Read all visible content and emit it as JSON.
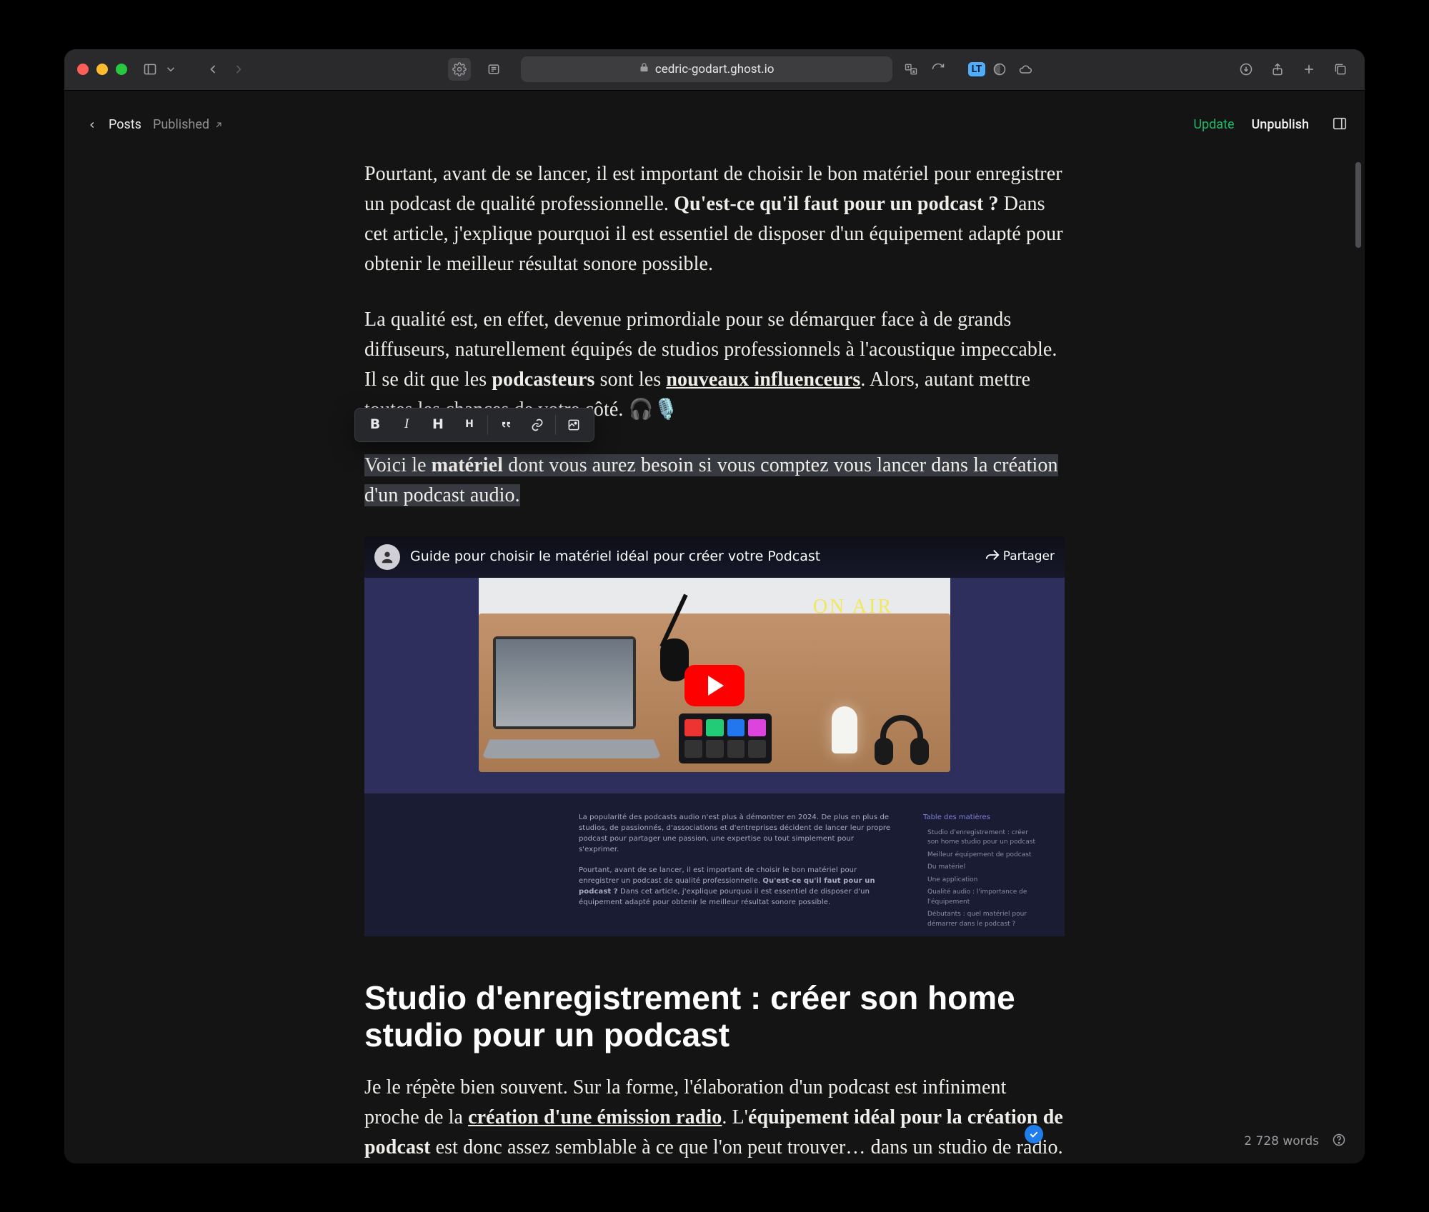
{
  "browser": {
    "url_display": "cedric-godart.ghost.io",
    "lt_badge": "LT"
  },
  "editor_header": {
    "back_label": "Posts",
    "status": "Published",
    "action_update": "Update",
    "action_unpublish": "Unpublish"
  },
  "article": {
    "p1_a": "Pourtant, avant de se lancer, il est important de choisir le bon matériel pour enregistrer un podcast de qualité professionnelle. ",
    "p1_bold": "Qu'est-ce qu'il faut pour un podcast ?",
    "p1_b": " Dans cet article, j'explique pourquoi il est essentiel de disposer d'un équipement adapté pour obtenir le meilleur résultat sonore possible.",
    "p2_a": "La qualité est, en effet, devenue primordiale pour se démarquer face à de grands diffuseurs, naturellement équipés de studios professionnels à l'acoustique impeccable. Il se dit que les ",
    "p2_bold": "podcasteurs",
    "p2_b": " sont les ",
    "p2_link": "nouveaux influenceurs",
    "p2_c": ". Alors, autant mettre toutes les chances de votre côté. 🎧🎙️",
    "p3_a": "Voici le ",
    "p3_bold": "matériel",
    "p3_b": " dont vous aurez besoin si vous comptez vous lancer dans la création d'un podcast audio.",
    "h2": "Studio d'enregistrement : créer son home studio pour un podcast",
    "p4_a": "Je le répète bien souvent. Sur la forme, l'élaboration d'un podcast est infiniment proche de la ",
    "p4_link": "création d'une émission radio",
    "p4_b": ". L'",
    "p4_bold": "équipement idéal pour la création de podcast",
    "p4_c": " est donc assez semblable à ce que l'on peut trouver… dans un studio de radio."
  },
  "video": {
    "title": "Guide pour choisir le matériel idéal pour créer votre Podcast",
    "share": "Partager",
    "onair": "ON AIR",
    "toc_title": "Table des matières",
    "excerpt1": "La popularité des podcasts audio n'est plus à démontrer en 2024. De plus en plus de studios, de passionnés, d'associations et d'entreprises décident de lancer leur propre podcast pour partager une passion, une expertise ou tout simplement pour s'exprimer.",
    "excerpt2_a": "Pourtant, avant de se lancer, il est important de choisir le bon matériel pour enregistrer un podcast de qualité professionnelle. ",
    "excerpt2_bold": "Qu'est-ce qu'il faut pour un podcast ?",
    "excerpt2_b": " Dans cet article, j'explique pourquoi il est essentiel de disposer d'un équipement adapté pour obtenir le meilleur résultat sonore possible.",
    "toc_items": [
      "Studio d'enregistrement : créer son home studio pour un podcast",
      "Meilleur équipement de podcast",
      "Du matériel",
      "Une application",
      "Qualité audio : l'importance de l'équipement",
      "Débutants : quel matériel pour démarrer dans le podcast ?"
    ]
  },
  "toolbar": {
    "bold": "B",
    "italic": "I",
    "h_big": "H",
    "h_small": "H",
    "quote": "❝",
    "link": "link",
    "snippet": "snippet"
  },
  "footer": {
    "wordcount": "2 728 words"
  }
}
